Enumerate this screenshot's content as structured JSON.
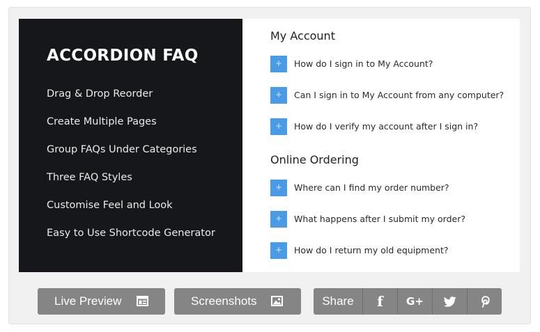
{
  "banner": {
    "title": "ACCORDION FAQ",
    "features": [
      "Drag & Drop Reorder",
      "Create Multiple Pages",
      "Group FAQs Under Categories",
      "Three FAQ Styles",
      "Customise Feel and Look",
      "Easy to Use Shortcode Generator"
    ],
    "sections": [
      {
        "heading": "My Account",
        "questions": [
          "How do I sign in to My Account?",
          "Can I sign in to My Account from any computer?",
          "How do I verify my account after I sign in?"
        ]
      },
      {
        "heading": "Online Ordering",
        "questions": [
          "Where can I find my order number?",
          "What happens after I submit my order?",
          "How do I return my old equipment?"
        ]
      }
    ],
    "plus_glyph": "+",
    "accent_color": "#4a9ae6",
    "dark_bg": "#16171b"
  },
  "actions": {
    "live_preview": {
      "label": "Live Preview",
      "icon": "layout-window-icon"
    },
    "screenshots": {
      "label": "Screenshots",
      "icon": "image-icon"
    },
    "share": {
      "label": "Share",
      "facebook_glyph": "f",
      "gplus_glyph": "G+",
      "networks": [
        "facebook-icon",
        "google-plus-icon",
        "twitter-icon",
        "pinterest-icon"
      ]
    },
    "button_color": "#858585"
  }
}
